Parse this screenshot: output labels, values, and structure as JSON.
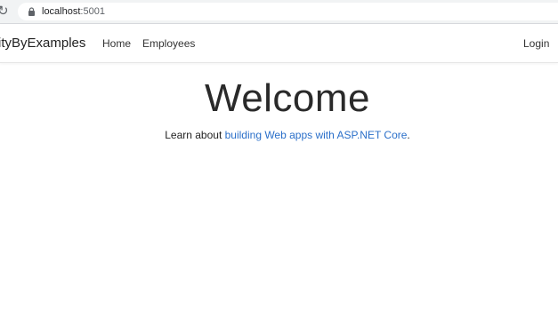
{
  "browser": {
    "url_host": "localhost",
    "url_port": ":5001",
    "icons": [
      "reload-icon",
      "lock-icon"
    ]
  },
  "navbar": {
    "brand": "ityByExamples",
    "links": [
      {
        "label": "Home"
      },
      {
        "label": "Employees"
      }
    ],
    "login_label": "Login"
  },
  "main": {
    "title": "Welcome",
    "lead_prefix": "Learn about ",
    "lead_link": "building Web apps with ASP.NET Core",
    "lead_suffix": "."
  },
  "colors": {
    "link": "#2a6fc9",
    "chrome_bar": "#f1f3f4"
  }
}
